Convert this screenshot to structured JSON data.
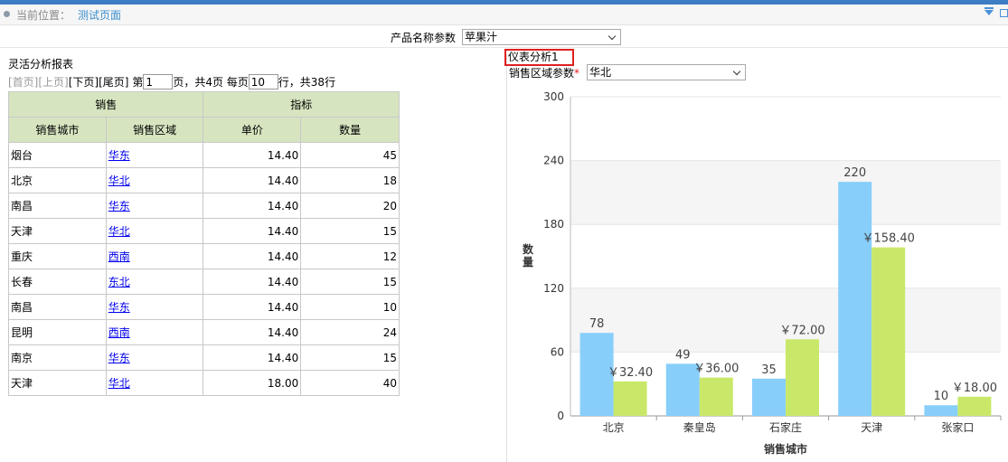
{
  "crumb": {
    "label": "当前位置：",
    "page": "测试页面"
  },
  "params": {
    "product_label": "产品名称参数",
    "product_value": "苹果汁"
  },
  "report": {
    "title": "灵活分析报表",
    "pager": {
      "first": "[首页]",
      "prev": "[上页]",
      "next": "[下页]",
      "last": "[尾页]",
      "page_prefix": "第",
      "page_value": "1",
      "page_suffix": "页，共4页 每页",
      "size_value": "10",
      "size_suffix": "行，共38行"
    },
    "header_groups": [
      "销售",
      "指标"
    ],
    "columns": [
      "销售城市",
      "销售区域",
      "单价",
      "数量"
    ],
    "rows": [
      {
        "city": "烟台",
        "region": "华东",
        "price": "14.40",
        "qty": "45"
      },
      {
        "city": "北京",
        "region": "华北",
        "price": "14.40",
        "qty": "18"
      },
      {
        "city": "南昌",
        "region": "华东",
        "price": "14.40",
        "qty": "20"
      },
      {
        "city": "天津",
        "region": "华北",
        "price": "14.40",
        "qty": "15"
      },
      {
        "city": "重庆",
        "region": "西南",
        "price": "14.40",
        "qty": "12"
      },
      {
        "city": "长春",
        "region": "东北",
        "price": "14.40",
        "qty": "15"
      },
      {
        "city": "南昌",
        "region": "华东",
        "price": "14.40",
        "qty": "10"
      },
      {
        "city": "昆明",
        "region": "西南",
        "price": "14.40",
        "qty": "24"
      },
      {
        "city": "南京",
        "region": "华东",
        "price": "14.40",
        "qty": "15"
      },
      {
        "city": "天津",
        "region": "华北",
        "price": "18.00",
        "qty": "40"
      }
    ]
  },
  "gauge": {
    "title": "仪表分析1",
    "region_label": "销售区域参数",
    "required_mark": "*",
    "region_value": "华北"
  },
  "colors": {
    "topbar": "#3d7dc5",
    "header_bg": "#d6e5c0",
    "series_qty": "#87cefa",
    "series_amount": "#c9e86a",
    "highlight": "#e02020"
  },
  "chart_data": {
    "type": "bar",
    "categories": [
      "北京",
      "秦皇岛",
      "石家庄",
      "天津",
      "张家口"
    ],
    "series": [
      {
        "values": [
          78,
          49,
          35,
          220,
          10
        ],
        "labels": [
          "78",
          "49",
          "35",
          "220",
          "10"
        ]
      },
      {
        "values": [
          32.4,
          36,
          72,
          158.4,
          18
        ],
        "labels": [
          "￥32.40",
          "￥36.00",
          "￥72.00",
          "￥158.40",
          "￥18.00"
        ]
      }
    ],
    "xlabel": "销售城市",
    "ylabel": "数量",
    "ylim": [
      0,
      300
    ],
    "yticks": [
      0,
      60,
      120,
      180,
      240,
      300
    ],
    "grid": "alternating-bands",
    "legend": "none"
  }
}
